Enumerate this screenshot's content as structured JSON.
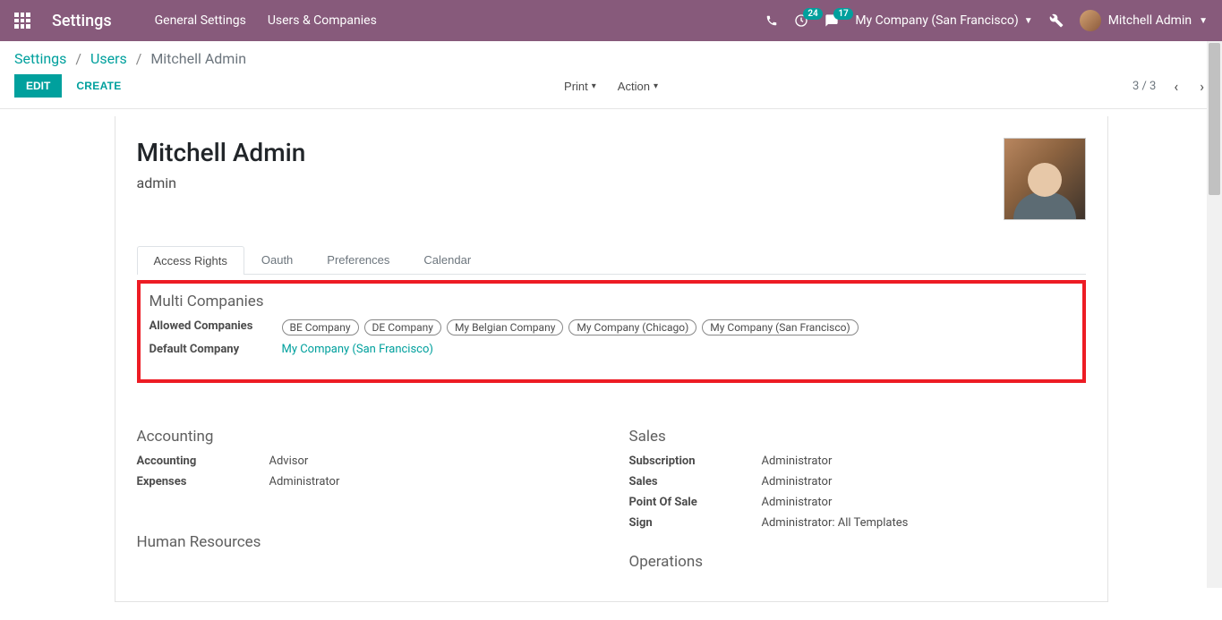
{
  "topbar": {
    "app_title": "Settings",
    "menu": [
      "General Settings",
      "Users & Companies"
    ],
    "activities_badge": "24",
    "messages_badge": "17",
    "company": "My Company (San Francisco)",
    "user_name": "Mitchell Admin"
  },
  "breadcrumbs": {
    "items": [
      "Settings",
      "Users"
    ],
    "current": "Mitchell Admin"
  },
  "controlbar": {
    "edit": "EDIT",
    "create": "CREATE",
    "print": "Print",
    "action": "Action",
    "pager": "3 / 3"
  },
  "record": {
    "name": "Mitchell Admin",
    "login": "admin"
  },
  "tabs": [
    "Access Rights",
    "Oauth",
    "Preferences",
    "Calendar"
  ],
  "multi_companies": {
    "title": "Multi Companies",
    "allowed_label": "Allowed Companies",
    "allowed": [
      "BE Company",
      "DE Company",
      "My Belgian Company",
      "My Company (Chicago)",
      "My Company (San Francisco)"
    ],
    "default_label": "Default Company",
    "default": "My Company (San Francisco)"
  },
  "accounting": {
    "title": "Accounting",
    "rows": [
      {
        "label": "Accounting",
        "value": "Advisor"
      },
      {
        "label": "Expenses",
        "value": "Administrator"
      }
    ]
  },
  "sales": {
    "title": "Sales",
    "rows": [
      {
        "label": "Subscription",
        "value": "Administrator"
      },
      {
        "label": "Sales",
        "value": "Administrator"
      },
      {
        "label": "Point Of Sale",
        "value": "Administrator"
      },
      {
        "label": "Sign",
        "value": "Administrator: All Templates"
      }
    ]
  },
  "hr": {
    "title": "Human Resources"
  },
  "operations": {
    "title": "Operations"
  }
}
